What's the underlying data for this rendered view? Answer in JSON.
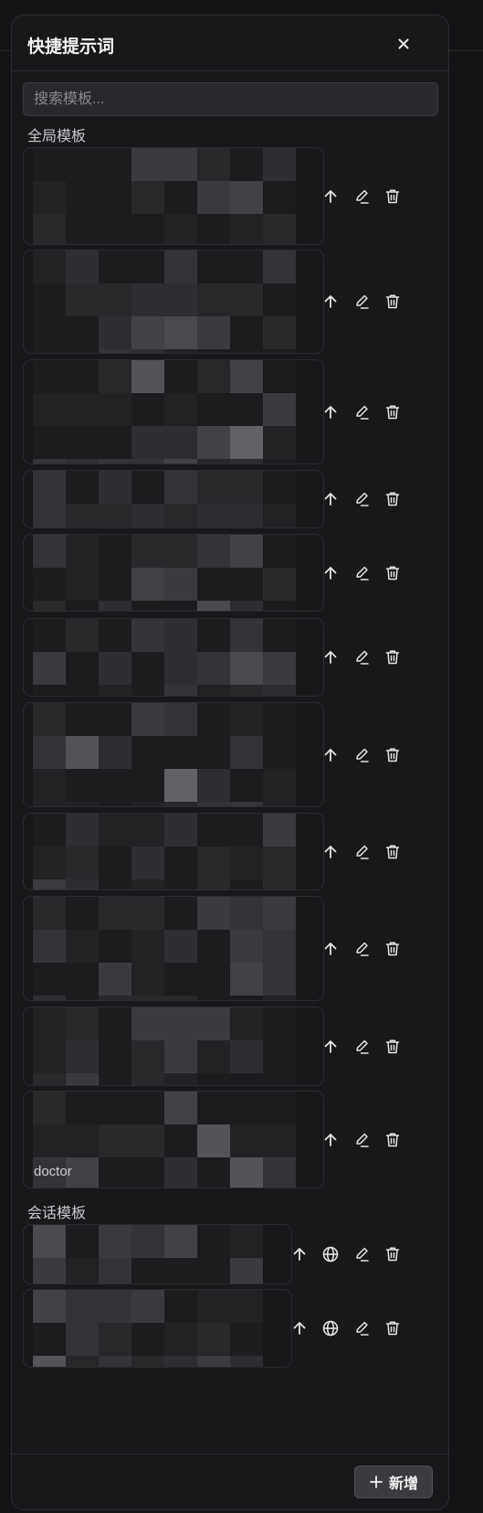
{
  "dialog": {
    "title": "快捷提示词"
  },
  "search": {
    "placeholder": "搜索模板..."
  },
  "sections": {
    "global_label": "全局模板",
    "session_label": "会话模板"
  },
  "global_templates": [
    {
      "text": "",
      "actions": [
        "arrow-up-icon",
        "edit-icon",
        "trash-icon"
      ]
    },
    {
      "text": "",
      "actions": [
        "arrow-up-icon",
        "edit-icon",
        "trash-icon"
      ]
    },
    {
      "text": "",
      "actions": [
        "arrow-up-icon",
        "edit-icon",
        "trash-icon"
      ]
    },
    {
      "text": "",
      "actions": [
        "arrow-up-icon",
        "edit-icon",
        "trash-icon"
      ]
    },
    {
      "text": "",
      "actions": [
        "arrow-up-icon",
        "edit-icon",
        "trash-icon"
      ]
    },
    {
      "text": "",
      "actions": [
        "arrow-up-icon",
        "edit-icon",
        "trash-icon"
      ]
    },
    {
      "text": "",
      "actions": [
        "arrow-up-icon",
        "edit-icon",
        "trash-icon"
      ]
    },
    {
      "text": "",
      "actions": [
        "arrow-up-icon",
        "edit-icon",
        "trash-icon"
      ]
    },
    {
      "text": "",
      "actions": [
        "arrow-up-icon",
        "edit-icon",
        "trash-icon"
      ]
    },
    {
      "text": "",
      "actions": [
        "arrow-up-icon",
        "edit-icon",
        "trash-icon"
      ]
    },
    {
      "text": "doctor",
      "actions": [
        "arrow-up-icon",
        "edit-icon",
        "trash-icon"
      ]
    }
  ],
  "session_templates": [
    {
      "text": "",
      "actions": [
        "arrow-up-icon",
        "globe-icon",
        "edit-icon",
        "trash-icon"
      ]
    },
    {
      "text": "",
      "actions": [
        "arrow-up-icon",
        "globe-icon",
        "edit-icon",
        "trash-icon"
      ]
    }
  ],
  "footer": {
    "add_label": "新增"
  }
}
